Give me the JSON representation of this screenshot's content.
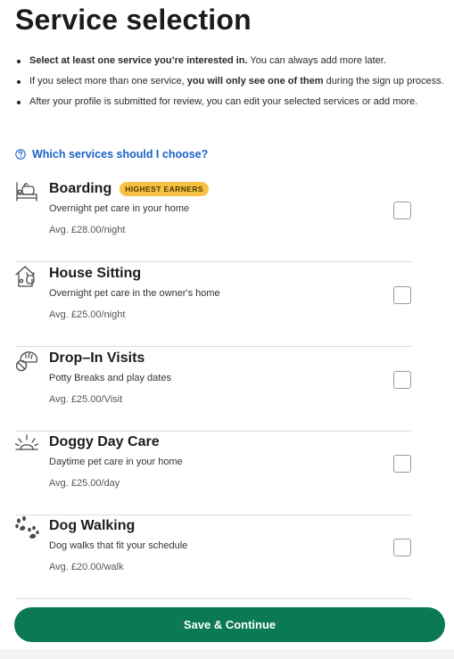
{
  "page": {
    "title": "Service selection"
  },
  "instructions": [
    {
      "bold": "Select at least one service you’re interested in.",
      "after": " You can always add more later."
    },
    {
      "before": "If you select more than one service, ",
      "bold": "you will only see one of them",
      "after": " during the sign up process."
    },
    {
      "text": "After your profile is submitted for review, you can edit your selected services or add more."
    }
  ],
  "help": {
    "label": "Which services should I choose?",
    "icon": "question-circle-icon"
  },
  "services": [
    {
      "name": "Boarding",
      "badge": "HIGHEST EARNERS",
      "description": "Overnight pet care in your home",
      "price": "Avg. £28.00/night",
      "icon": "boarding-icon",
      "checked": false
    },
    {
      "name": "House Sitting",
      "badge": "",
      "description": "Overnight pet care in the owner's home",
      "price": "Avg. £25.00/night",
      "icon": "house-sitting-icon",
      "checked": false
    },
    {
      "name": "Drop–In Visits",
      "badge": "",
      "description": "Potty Breaks and play dates",
      "price": "Avg. £25.00/Visit",
      "icon": "drop-in-visits-icon",
      "checked": false
    },
    {
      "name": "Doggy Day Care",
      "badge": "",
      "description": "Daytime pet care in your home",
      "price": "Avg. £25.00/day",
      "icon": "doggy-day-care-icon",
      "checked": false
    },
    {
      "name": "Dog Walking",
      "badge": "",
      "description": "Dog walks that fit your schedule",
      "price": "Avg. £20.00/walk",
      "icon": "dog-walking-icon",
      "checked": false
    }
  ],
  "footer": {
    "save_label": "Save & Continue"
  },
  "colors": {
    "primary": "#0b7a52",
    "link": "#1a63c7",
    "badge": "#f7c244"
  }
}
